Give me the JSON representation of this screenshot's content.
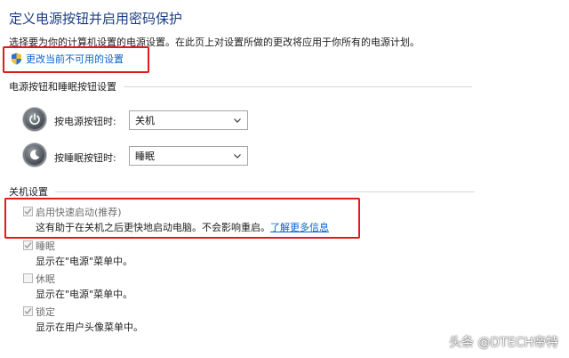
{
  "title": "定义电源按钮并启用密码保护",
  "description": "选择要为你的计算机设置的电源设置。在此页上对设置所做的更改将应用于你所有的电源计划。",
  "change_link": "更改当前不可用的设置",
  "sections": {
    "power_buttons": "电源按钮和睡眠按钮设置",
    "shutdown": "关机设置"
  },
  "power_button": {
    "label": "按电源按钮时:",
    "value": "关机"
  },
  "sleep_button": {
    "label": "按睡眠按钮时:",
    "value": "睡眠"
  },
  "shutdown_options": [
    {
      "label": "启用快速启动(推荐)",
      "desc": "这有助于在关机之后更快地启动电脑。不会影响重启。",
      "link": "了解更多信息",
      "checked": true
    },
    {
      "label": "睡眠",
      "desc": "显示在\"电源\"菜单中。",
      "checked": true
    },
    {
      "label": "休眠",
      "desc": "显示在\"电源\"菜单中。",
      "checked": false
    },
    {
      "label": "锁定",
      "desc": "显示在用户头像菜单中。",
      "checked": true
    }
  ],
  "watermark": "头条 @DTECH帝特",
  "colors": {
    "title": "#1c3d86",
    "link": "#0a63c9",
    "highlight": "#e01b1b"
  }
}
